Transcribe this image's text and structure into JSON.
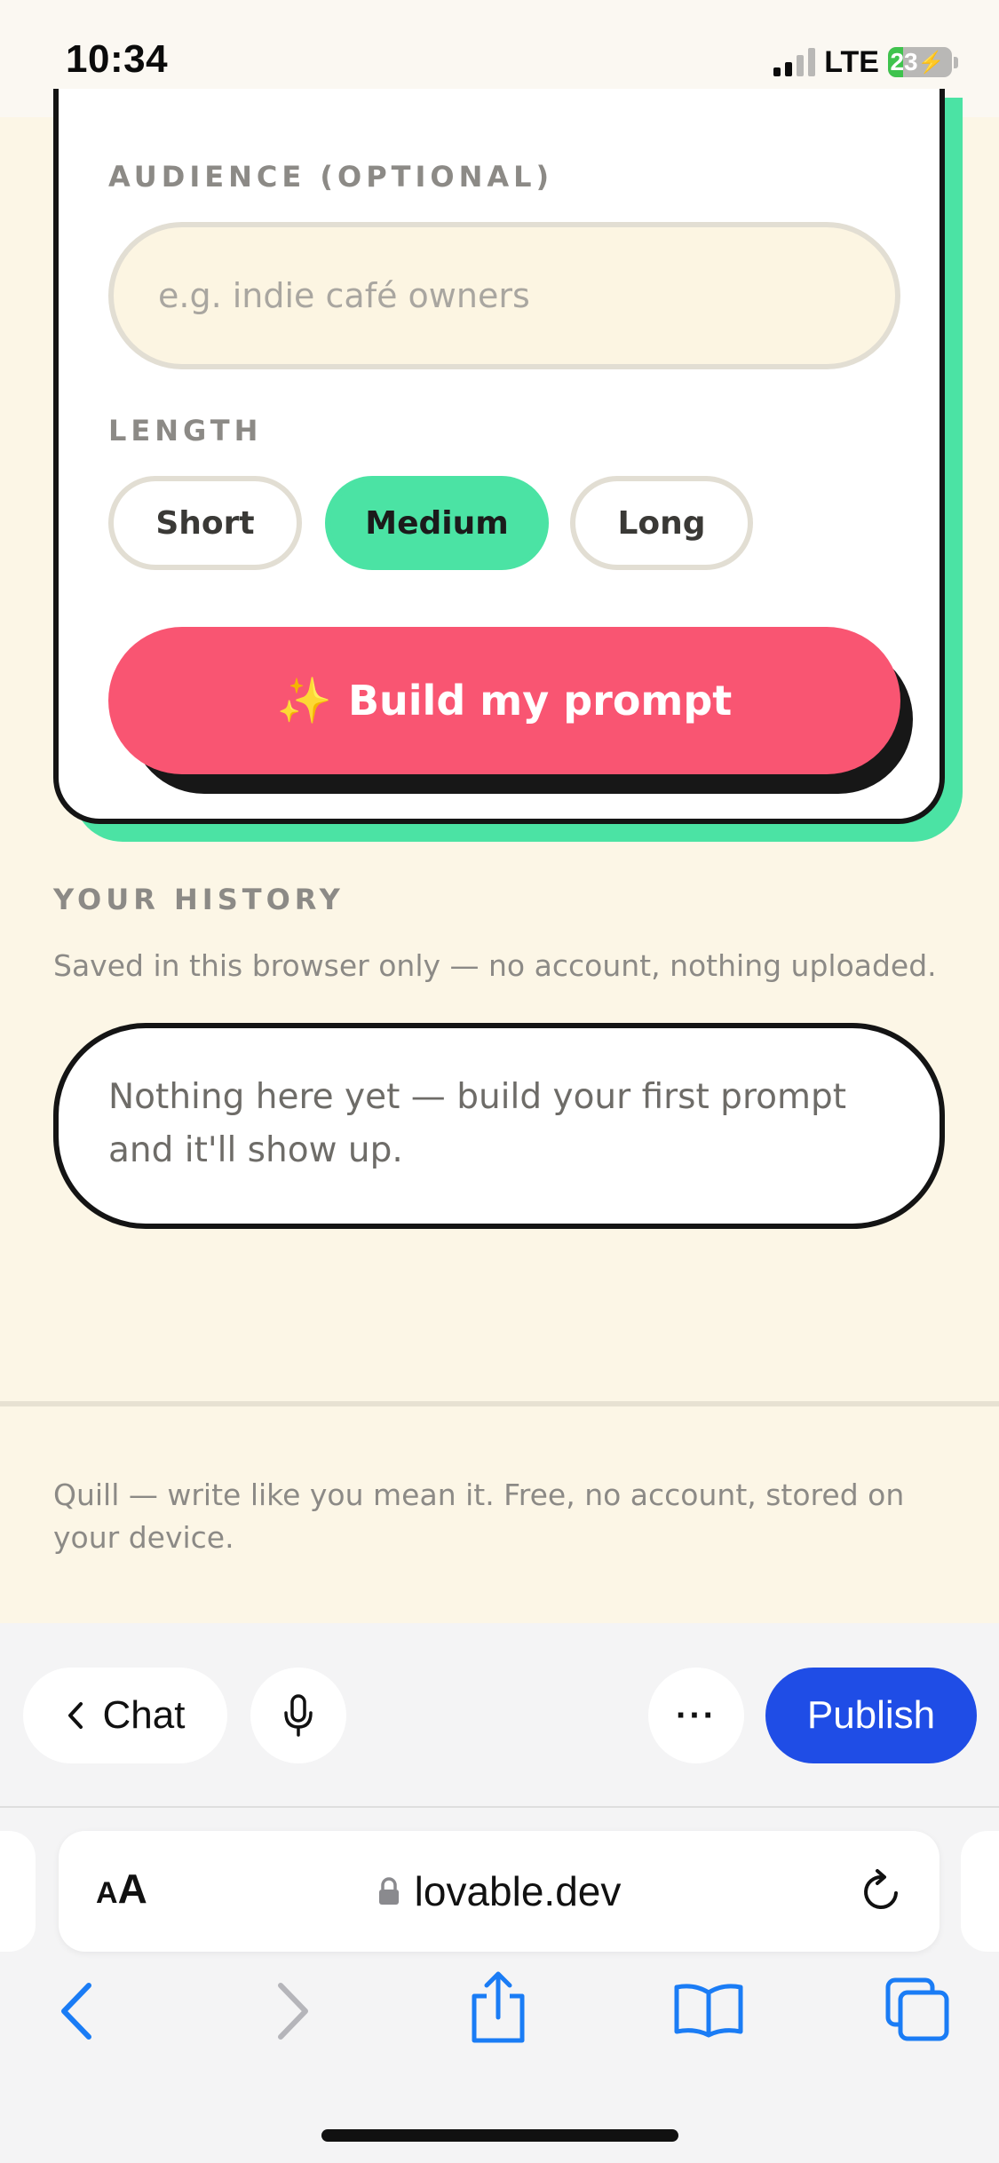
{
  "status_bar": {
    "time": "10:34",
    "network": "LTE",
    "battery": "23",
    "battery_level": 0.23,
    "signal_bars_active": 2
  },
  "form": {
    "audience_label": "AUDIENCE (OPTIONAL)",
    "audience_placeholder": "e.g. indie café owners",
    "audience_value": "",
    "length_label": "LENGTH",
    "length_options": [
      "Short",
      "Medium",
      "Long"
    ],
    "length_selected": "Medium",
    "build_sparkle": "✨",
    "build_label": "Build my prompt"
  },
  "history": {
    "title": "YOUR HISTORY",
    "note": "Saved in this browser only — no account, nothing uploaded.",
    "empty_text": "Nothing here yet — build your first prompt and it'll show up."
  },
  "footer": {
    "text": "Quill — write like you mean it. Free, no account, stored on your device."
  },
  "lovable_toolbar": {
    "chat_label": "Chat",
    "publish_label": "Publish",
    "more_label": "···"
  },
  "browser": {
    "aa_small": "A",
    "aa_big": "A",
    "url": "lovable.dev"
  },
  "colors": {
    "accent_green": "#4be3a4",
    "button_pink": "#f95572",
    "publish_blue": "#1f4de6",
    "safari_blue": "#1a7cf5"
  },
  "icons": {
    "chat_back": "chevron-left-icon",
    "mic": "microphone-icon",
    "lock": "lock-icon",
    "reload": "reload-icon",
    "back": "chevron-left-icon",
    "forward": "chevron-right-icon",
    "share": "share-icon",
    "bookmarks": "book-icon",
    "tabs": "tabs-icon"
  }
}
